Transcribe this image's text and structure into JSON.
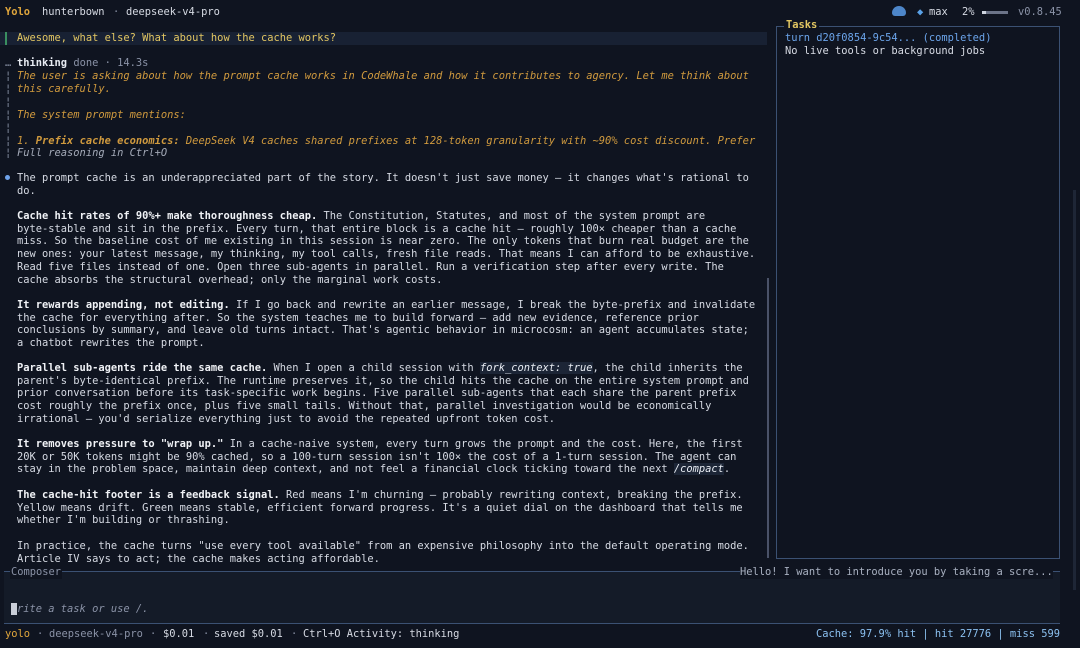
{
  "topbar": {
    "brand": "Yolo",
    "user": "hunterbown",
    "sep": "·",
    "model": "deepseek-v4-pro",
    "mode": "max",
    "percent": "2%",
    "version": "v0.8.45"
  },
  "transcript": {
    "user_message": "Awesome, what else? What about how the cache works?",
    "thinking_label": "thinking",
    "thinking_status": "done · 14.3s",
    "thinking_lines": [
      "The user is asking about how the prompt cache works in CodeWhale and how it contributes to agency. Let me think about",
      "this carefully.",
      "",
      "The system prompt mentions:",
      ""
    ],
    "thinking_list_number": "1. ",
    "thinking_list_bold": "Prefix cache economics:",
    "thinking_list_rest": " DeepSeek V4 caches shared prefixes at 128-token granularity with ~90% cost discount. Prefer",
    "full_reasoning": "Full reasoning in Ctrl+O",
    "intro_lines": [
      "The prompt cache is an underappreciated part of the story. It doesn't just save money — it changes what's rational to",
      "do."
    ],
    "p1_bold": "Cache hit rates of 90%+ make thoroughness cheap.",
    "p1_first_rest": " The Constitution, Statutes, and most of the system prompt are",
    "p1_lines": [
      "byte-stable and sit in the prefix. Every turn, that entire block is a cache hit — roughly 100× cheaper than a cache",
      "miss. So the baseline cost of me existing in this session is near zero. The only tokens that burn real budget are the",
      "new ones: your latest message, my thinking, my tool calls, fresh file reads. That means I can afford to be exhaustive.",
      "Read five files instead of one. Open three sub-agents in parallel. Run a verification step after every write. The",
      "cache absorbs the structural overhead; only the marginal work costs."
    ],
    "p2_bold": "It rewards appending, not editing.",
    "p2_first_rest": " If I go back and rewrite an earlier message, I break the byte-prefix and invalidate",
    "p2_lines": [
      "the cache for everything after. So the system teaches me to build forward — add new evidence, reference prior",
      "conclusions by summary, and leave old turns intact. That's agentic behavior in microcosm: an agent accumulates state;",
      "a chatbot rewrites the prompt."
    ],
    "p3_bold": "Parallel sub-agents ride the same cache.",
    "p3_first_mid": " When I open a child session with ",
    "p3_code": "fork_context: true",
    "p3_first_end": ", the child inherits the",
    "p3_lines": [
      "parent's byte-identical prefix. The runtime preserves it, so the child hits the cache on the entire system prompt and",
      "prior conversation before its task-specific work begins. Five parallel sub-agents that each share the parent prefix",
      "cost roughly the prefix once, plus five small tails. Without that, parallel investigation would be economically",
      "irrational — you'd serialize everything just to avoid the repeated upfront token cost."
    ],
    "p4_bold": "It removes pressure to \"wrap up.\"",
    "p4_first_rest": " In a cache-naive system, every turn grows the prompt and the cost. Here, the first",
    "p4_lines": [
      "20K or 50K tokens might be 90% cached, so a 100-turn session isn't 100× the cost of a 1-turn session. The agent can"
    ],
    "p4_last_start": "stay in the problem space, maintain deep context, and not feel a financial clock ticking toward the next ",
    "p4_code": "/compact",
    "p4_last_end": ".",
    "p5_bold": "The cache-hit footer is a feedback signal.",
    "p5_first_rest": " Red means I'm churning — probably rewriting context, breaking the prefix.",
    "p5_lines": [
      "Yellow means drift. Green means stable, efficient forward progress. It's a quiet dial on the dashboard that tells me",
      "whether I'm building or thrashing."
    ],
    "p6_lines": [
      "In practice, the cache turns \"use every tool available\" from an expensive philosophy into the default operating mode.",
      "Article IV says to act; the cache makes acting affordable."
    ]
  },
  "tasks": {
    "title": "Tasks",
    "turn": "turn d20f0854-9c54...",
    "turn_status": " (completed)",
    "empty": "No live tools or background jobs"
  },
  "composer": {
    "label": "Composer",
    "hint": "Hello! I want to introduce you by taking a scre...",
    "placeholder": "rite a task or use /."
  },
  "status": {
    "mode": "yolo",
    "model": "deepseek-v4-pro",
    "cost": "$0.01",
    "saved": "saved $0.01",
    "activity": "Ctrl+O Activity: thinking",
    "cache": "Cache: 97.9% hit | hit 27776 | miss 599",
    "sep": "·"
  },
  "colors": {
    "background": "#0f1420",
    "brand": "#e0a63c",
    "thinking": "#d09a3e",
    "accent_blue": "#6ba4ea",
    "tasks_title": "#e2c662",
    "border": "#3b5173"
  },
  "icons": [
    "whale-icon",
    "diamond-icon",
    "bullet-icon",
    "user-bar-icon"
  ]
}
